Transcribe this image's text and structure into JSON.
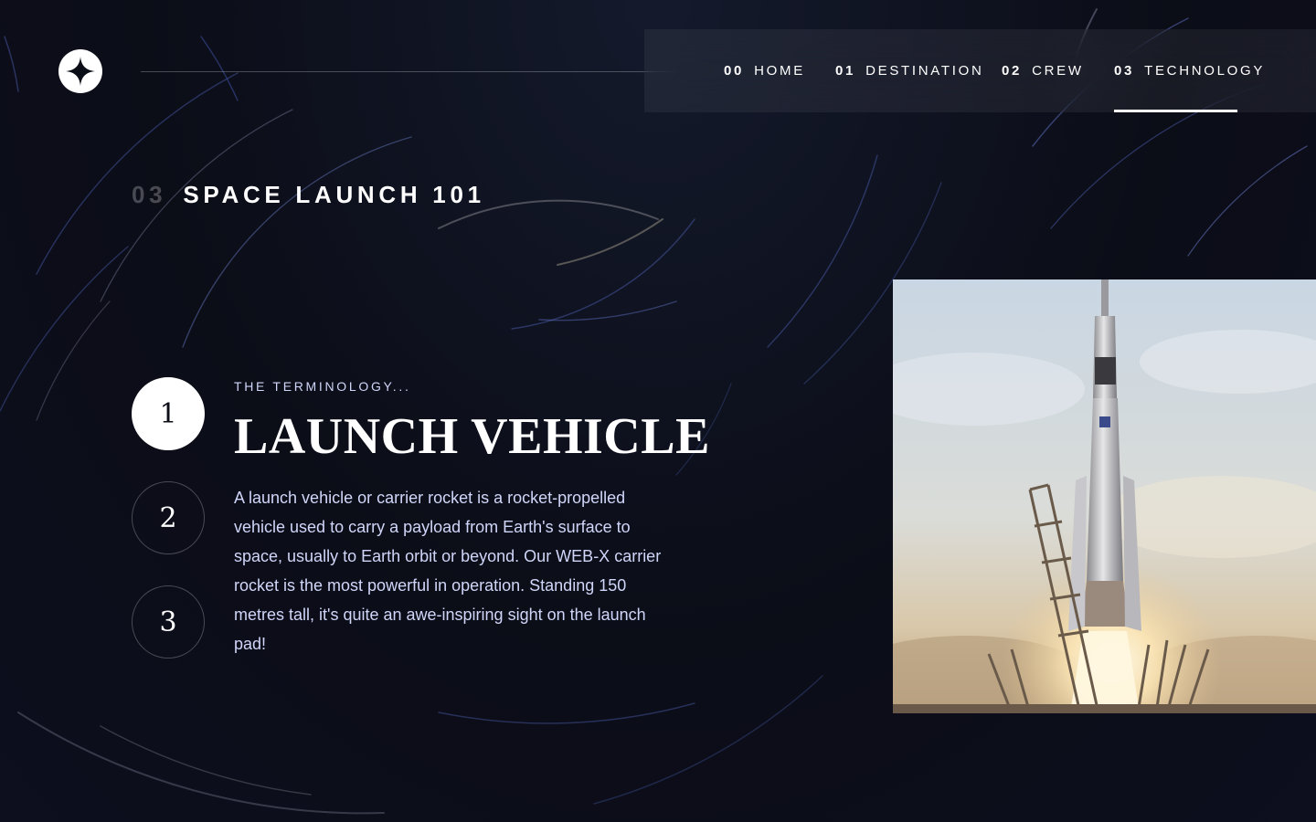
{
  "nav": {
    "items": [
      {
        "num": "00",
        "label": "HOME"
      },
      {
        "num": "01",
        "label": "DESTINATION"
      },
      {
        "num": "02",
        "label": "CREW"
      },
      {
        "num": "03",
        "label": "TECHNOLOGY"
      }
    ],
    "active": "TECHNOLOGY"
  },
  "page": {
    "heading_num": "03",
    "heading": "SPACE LAUNCH 101"
  },
  "stepper": {
    "steps": [
      "1",
      "2",
      "3"
    ],
    "active": "1"
  },
  "content": {
    "eyebrow": "THE TERMINOLOGY...",
    "title": "LAUNCH VEHICLE",
    "description": "A launch vehicle or carrier rocket is a rocket-propelled vehicle used to carry a payload from Earth's surface to space, usually to Earth orbit or beyond. Our WEB-X carrier rocket is the most powerful in operation. Standing 150 metres tall, it's quite an awe-inspiring sight on the launch pad!"
  },
  "colors": {
    "background": "#0b0d17",
    "text_muted": "#d0d6f9",
    "white": "#ffffff"
  },
  "icons": {
    "logo": "star-logo-icon"
  }
}
